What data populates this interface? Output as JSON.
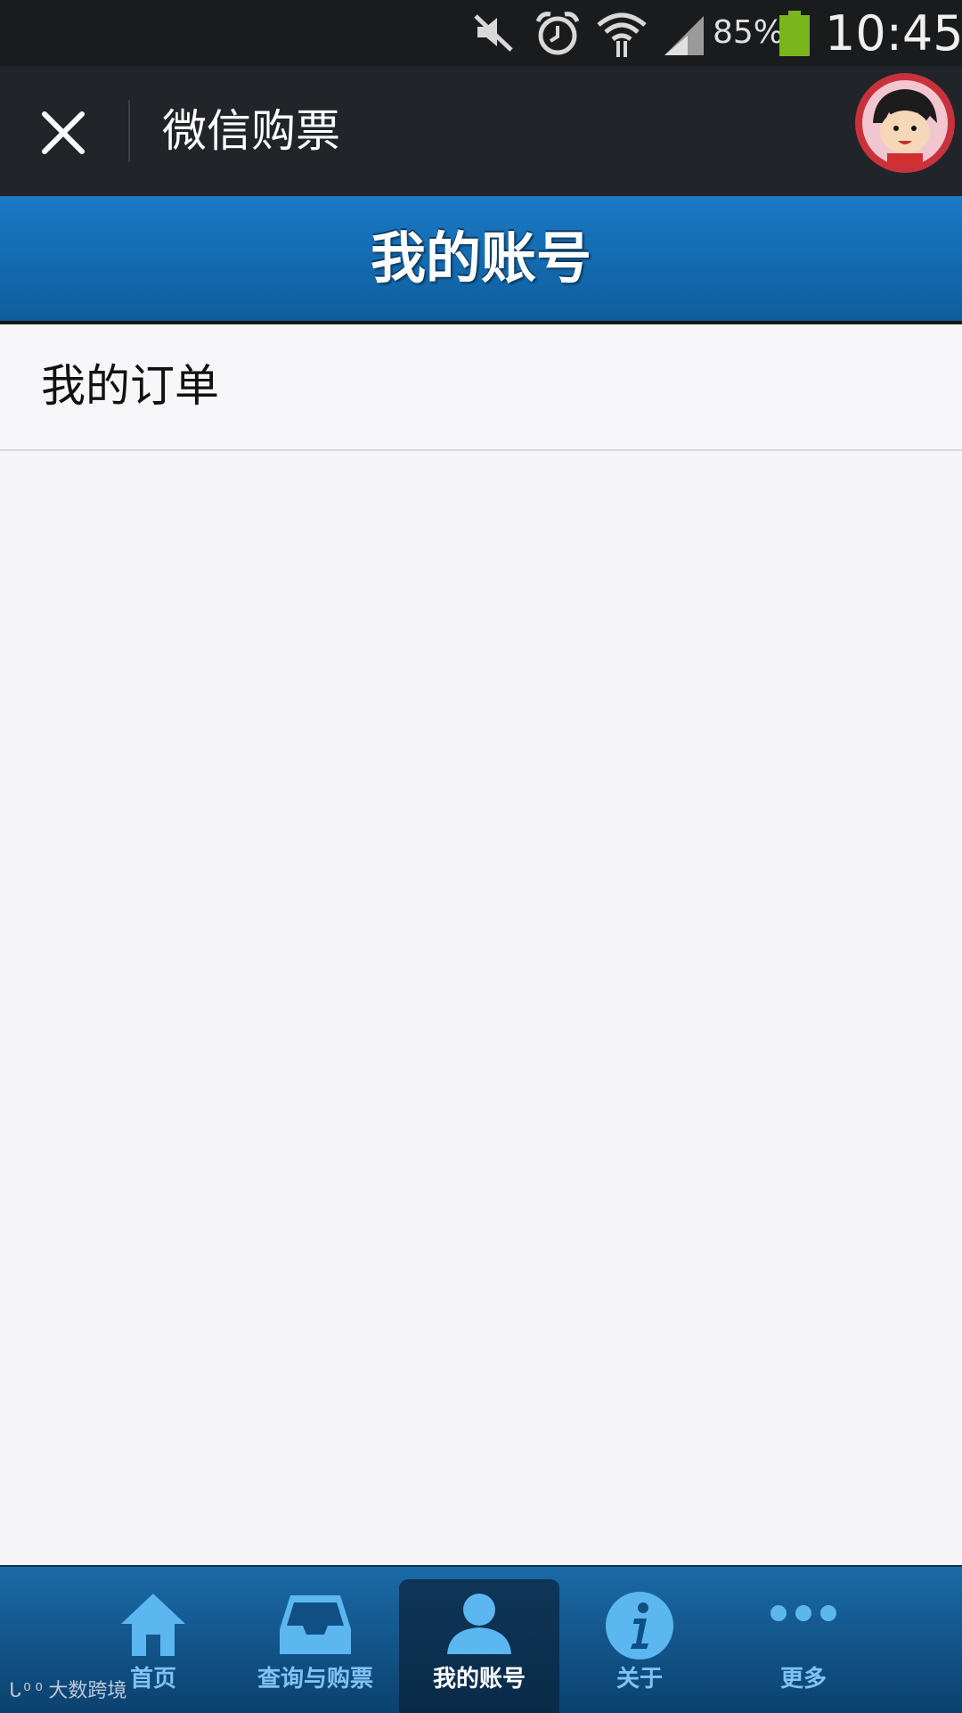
{
  "status_bar": {
    "battery_percent": "85%",
    "time": "10:45",
    "battery_level": 0.85,
    "icons": [
      "mute-icon",
      "alarm-icon",
      "wifi-icon",
      "signal-icon",
      "battery-icon"
    ],
    "battery_color": "#7ab51d"
  },
  "wechat_bar": {
    "title": "微信购票",
    "close_icon": "close-icon",
    "avatar": "avatar"
  },
  "page": {
    "title": "我的账号"
  },
  "list": {
    "items": [
      {
        "label": "我的订单"
      }
    ]
  },
  "tab_bar": {
    "active_tab": "我的账号",
    "tabs": [
      {
        "label": "首页",
        "icon": "home-icon"
      },
      {
        "label": "查询与购票",
        "icon": "inbox-icon"
      },
      {
        "label": "我的账号",
        "icon": "user-icon"
      },
      {
        "label": "关于",
        "icon": "info-icon"
      },
      {
        "label": "更多",
        "icon": "more-icon"
      }
    ]
  },
  "watermark": {
    "text": "大数跨境"
  },
  "colors": {
    "header_blue": "#1a79c4",
    "tab_label_blue": "#7fc3f2",
    "dark_bar": "#212529"
  }
}
